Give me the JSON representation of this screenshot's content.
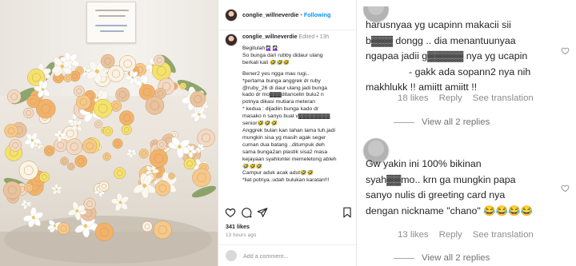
{
  "post": {
    "header": {
      "username": "conglie_willneverdie",
      "separator": "•",
      "follow_label": "Following"
    },
    "caption": {
      "username": "conglie_willneverdie",
      "edited": "Edited",
      "separator": "•",
      "time": "13h",
      "lines": [
        "Begitulah🤦🏻‍♀️🤦🏻‍♀️",
        "So bunga dari rubby didaur ulang",
        "berkali kali 🤣🤣🤣",
        "",
        "Bener2 yes ngga mau rugi..",
        "*pertama bunga anggrek dr ruby",
        "@ruby_26 di daur ulang jadi bunga",
        "kado dr mo▓▓▓ditancelin bulu2 n",
        "potnya dikasi mutiara meteran",
        "* kedua : dijadiin bunga kado dr",
        "masako n sanyo buat v▓▓▓▓▓▓▓▓",
        "senior🤣🤣🤣",
        "Anggrek bulan kan tahan lama tuh.jadi",
        "mungkin sisa yg masih agak seger",
        "cuman dua batang ..ditumpuk deh",
        "sama bunga2an plastik sisa2 masa",
        "kejayaan syahlontei memeletong ableh",
        "🤣🤣🤣",
        "Campur aduk acak adut🤣🤣",
        "*liat potnya..udah bulukan karatan!!!"
      ]
    },
    "likes": "341 likes",
    "time_ago": "13 hours ago",
    "comment_placeholder": "Add a comment..."
  },
  "comments": {
    "first": {
      "lines": [
        "harusnyaa yg ucapinn makacii sii",
        "b▓▓▓ dongg .. dia menantuunyaa",
        "ngapaa jadii g▓▓▓▓▓ nya yg ucapin",
        "- gakk ada sopann2 nya nih",
        "makhlukk !! amiitt amiitt !!"
      ],
      "likes": "18 likes",
      "reply": "Reply",
      "see_translation": "See translation",
      "view_replies": "View all 2 replies"
    },
    "second": {
      "lines": [
        "Gw yakin ini 100% bikinan",
        "syah▓▓mo.. krn ga mungkin papa",
        "sanyo nulis di greeting card nya",
        "dengan nickname \"chano\" 😂😂😂😂"
      ],
      "likes": "13 likes",
      "reply": "Reply",
      "see_translation": "See translation",
      "view_replies": "View all 2 replies"
    }
  },
  "colors": {
    "link": "#0095f6",
    "text": "#262626",
    "muted": "#8e8e8e",
    "like_red": "#ed4956"
  },
  "icons": {
    "actions": [
      "heart-icon",
      "comment-icon",
      "share-icon",
      "bookmark-icon"
    ],
    "comment_like": "heart-icon",
    "emoji": "smiley-icon"
  }
}
